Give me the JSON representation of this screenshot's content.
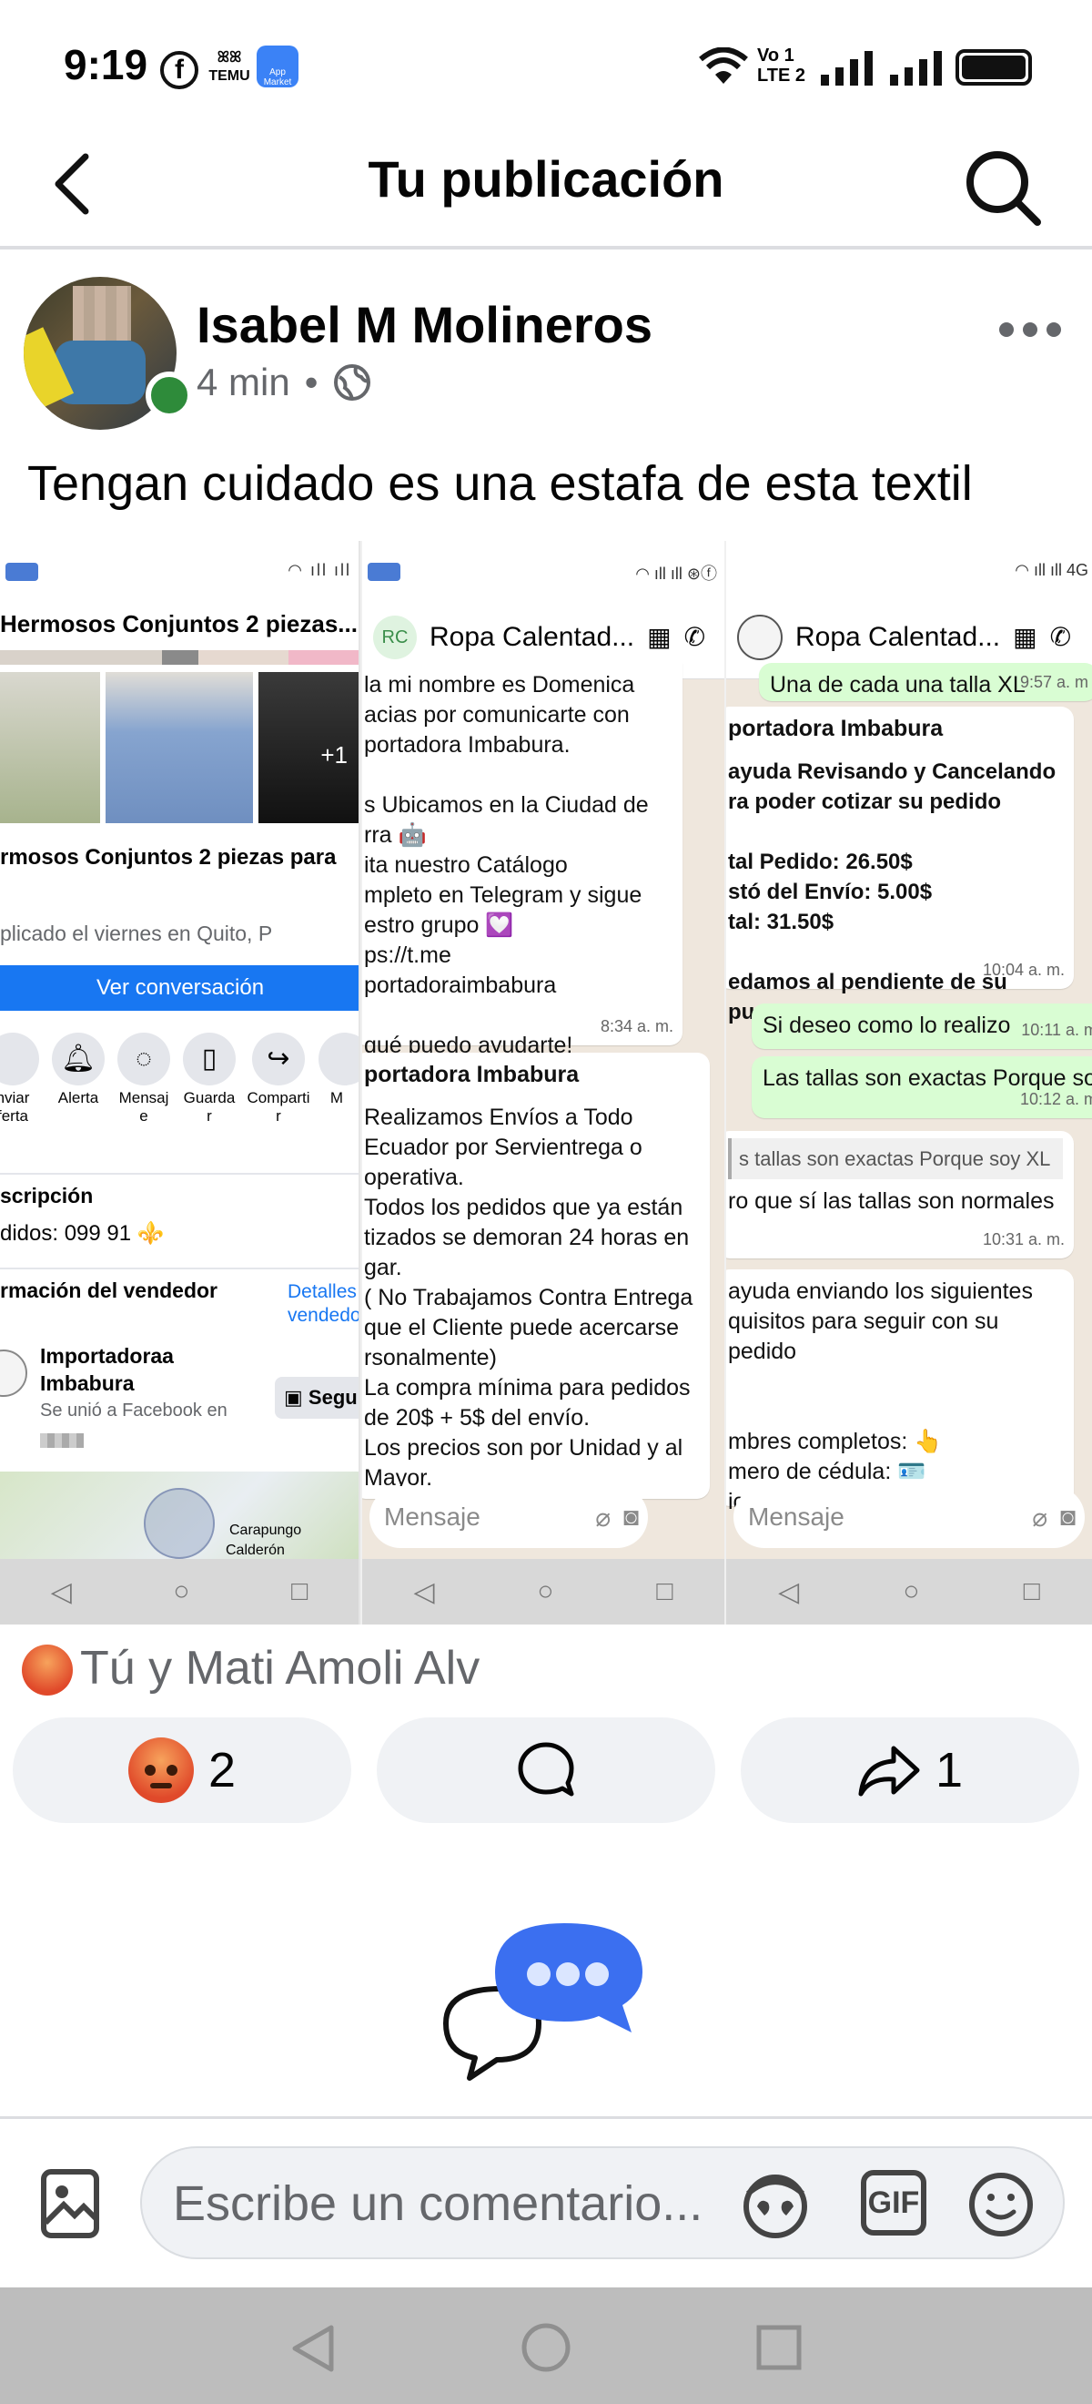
{
  "status_bar": {
    "time": "9:19",
    "left_icons": [
      "facebook-icon",
      "temu-icon",
      "app-market-icon"
    ],
    "temu_label": "TEMU",
    "app_market_label": "App Market",
    "volte_label": "Vo 1 LTE 2",
    "right_icons": [
      "wifi-icon",
      "signal-icon",
      "signal-icon",
      "battery-icon"
    ]
  },
  "header": {
    "title": "Tu publicación",
    "back_icon": "chevron-left-icon",
    "search_icon": "search-icon"
  },
  "post": {
    "author": "Isabel M Molineros",
    "time": "4 min",
    "separator": "•",
    "privacy_icon": "globe-icon",
    "text": "Tengan cuidado es una estafa de esta textil",
    "more_icon": "more-horizontal-icon"
  },
  "gallery": {
    "screenshot1": {
      "title": "Hermosos Conjuntos 2 piezas...",
      "photo_more": "+1",
      "listing_title": "rmosos Conjuntos 2 piezas para",
      "published": "plicado el viernes en Quito, P",
      "view_conversation": "Ver conversación",
      "actions": [
        "nviar\nferta",
        "Alerta",
        "Mensaj\ne",
        "Guarda\nr",
        "Comparti\nr",
        "M"
      ],
      "description_heading": "scripción",
      "description_text": "didos: 099 91 ⚜️",
      "seller_heading": "rmación del vendedor",
      "seller_details": "Detalles\nvendedo",
      "seller_name": "Importadoraa\nImbabura",
      "seller_joined": "Se unió a Facebook en",
      "follow_button": "Segu",
      "map_labels": [
        "Carapungo",
        "Calderón"
      ]
    },
    "screenshot2": {
      "chat_avatar": "RC",
      "chat_name": "Ropa Calentad...",
      "messages": [
        {
          "text": "la mi nombre es Domenica\nacias por comunicarte con\nportadora Imbabura.\n\ns Ubicamos en la Ciudad de\nrra 🤖\nita nuestro Catálogo\nmpleto en Telegram y sigue\nestro grupo 💟\nps://t.me\nportadoraimbabura\n\nqué puedo ayudarte!",
          "time": "8:34 a. m."
        },
        {
          "title": "portadora Imbabura",
          "text": "Realizamos Envíos a Todo\nEcuador por Servientrega o\noperativa.\nTodos los pedidos que ya están\ntizados se demoran 24 horas en\ngar.\n( No Trabajamos Contra Entrega\nque el Cliente puede acercarse\nrsonalmente)\nLa compra mínima para pedidos\nde 20$ + 5$ del envío.\nLos precios son por Unidad y al\n Mayor."
        }
      ],
      "input_placeholder": "Mensaje"
    },
    "screenshot3": {
      "chat_name": "Ropa Calentad...",
      "messages": [
        {
          "text": "Una de cada una talla XL",
          "time": "9:57 a. m",
          "out": true
        },
        {
          "title": "portadora Imbabura",
          "text": "ayuda Revisando y Cancelando\nra poder cotizar su pedido\n\ntal Pedido: 26.50$\nstó del Envío: 5.00$\ntal: 31.50$\n\nedamos al pendiente de su\npuesta",
          "time": "10:04 a. m."
        },
        {
          "text": "Si deseo como lo realizo",
          "time": "10:11 a. m",
          "out": true
        },
        {
          "text": "Las tallas son exactas Porque soy",
          "time": "10:12 a. m",
          "out": true
        },
        {
          "quote": "s tallas son exactas Porque soy XL",
          "text": "ro que sí las tallas son normales",
          "time": "10:31 a. m."
        },
        {
          "text": "ayuda enviando los siguientes\nquisitos para seguir con su pedido\n\n\nmbres completos: 👆\nmero de cédula: 🪪\nicación (Ya sea para el domicilio"
        }
      ],
      "input_placeholder": "Mensaje"
    }
  },
  "reactions": {
    "summary": "Tú y Mati Amoli Alv",
    "reaction_count": "2",
    "share_count": "1"
  },
  "composer": {
    "placeholder": "Escribe un comentario...",
    "gif_label": "GIF",
    "icons": [
      "image-icon",
      "avatar-sticker-icon",
      "gif-icon",
      "emoji-icon"
    ]
  },
  "colors": {
    "facebook_blue": "#1877f2",
    "online_green": "#2e8b3a",
    "pill_bg": "#f0f2f5",
    "secondary_text": "#65676b"
  }
}
